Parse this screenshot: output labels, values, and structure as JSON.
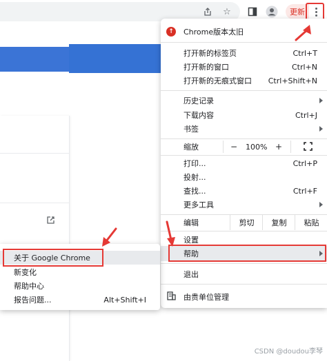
{
  "toolbar": {
    "update_label": "更新",
    "icons": [
      "share-icon",
      "star-icon",
      "side-panel-icon",
      "profile-icon",
      "kebab-menu-icon"
    ]
  },
  "menu": {
    "update_item": "Chrome版本太旧",
    "new_tab": {
      "label": "打开新的标签页",
      "shortcut": "Ctrl+T"
    },
    "new_window": {
      "label": "打开新的窗口",
      "shortcut": "Ctrl+N"
    },
    "incognito": {
      "label": "打开新的无痕式窗口",
      "shortcut": "Ctrl+Shift+N"
    },
    "history": {
      "label": "历史记录"
    },
    "downloads": {
      "label": "下载内容",
      "shortcut": "Ctrl+J"
    },
    "bookmarks": {
      "label": "书签"
    },
    "zoom": {
      "label": "缩放",
      "minus": "−",
      "value": "100%",
      "plus": "+"
    },
    "print": {
      "label": "打印...",
      "shortcut": "Ctrl+P"
    },
    "cast": {
      "label": "投射..."
    },
    "find": {
      "label": "查找...",
      "shortcut": "Ctrl+F"
    },
    "more_tools": {
      "label": "更多工具"
    },
    "edit": {
      "label": "编辑",
      "cut": "剪切",
      "copy": "复制",
      "paste": "粘贴"
    },
    "settings": {
      "label": "设置"
    },
    "help": {
      "label": "帮助"
    },
    "exit": {
      "label": "退出"
    },
    "managed": {
      "label": "由贵单位管理"
    }
  },
  "submenu": {
    "about": {
      "label": "关于 Google Chrome"
    },
    "whats_new": {
      "label": "新变化"
    },
    "help_center": {
      "label": "帮助中心"
    },
    "report": {
      "label": "报告问题...",
      "shortcut": "Alt+Shift+I"
    }
  },
  "watermark": "CSDN @doudou李琴",
  "colors": {
    "annotation_red": "#e53935",
    "accent_blue": "#3572d4"
  }
}
